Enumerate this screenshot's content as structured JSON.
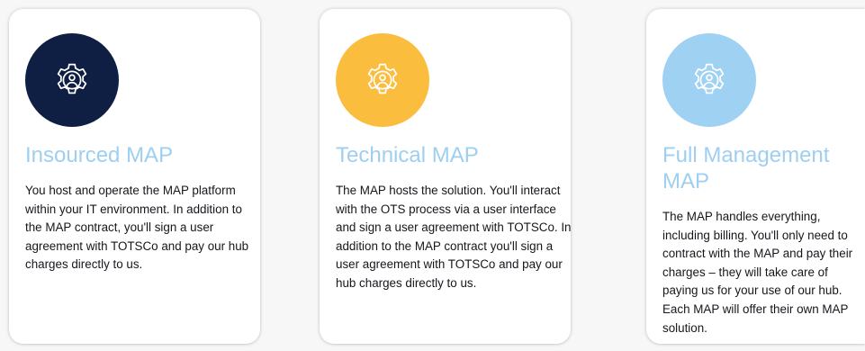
{
  "cards": [
    {
      "icon": "gear-person-icon",
      "icon_bg": "#0f1f44",
      "title": "Insourced MAP",
      "description": "You host and operate the MAP platform within your IT environment. In addition to the MAP contract, you'll sign a user agreement with TOTSCo and pay our hub charges directly to us."
    },
    {
      "icon": "gear-person-icon",
      "icon_bg": "#fbbd3d",
      "title": "Technical MAP",
      "description": "The MAP hosts the solution. You'll interact with the OTS process via a user interface and sign a user agreement with TOTSCo. In addition to the MAP contract you'll sign a user agreement with TOTSCo and pay our hub charges directly to us."
    },
    {
      "icon": "gear-person-icon",
      "icon_bg": "#9fd1f3",
      "title": "Full Management MAP",
      "description": "The MAP handles everything, including billing. You'll only need to contract with the MAP and pay their charges – they will take care of paying us for your use of our hub. Each MAP will offer their own MAP solution."
    }
  ],
  "colors": {
    "title": "#9fcff0",
    "text": "#15171c",
    "icon_stroke": "#ffffff"
  }
}
